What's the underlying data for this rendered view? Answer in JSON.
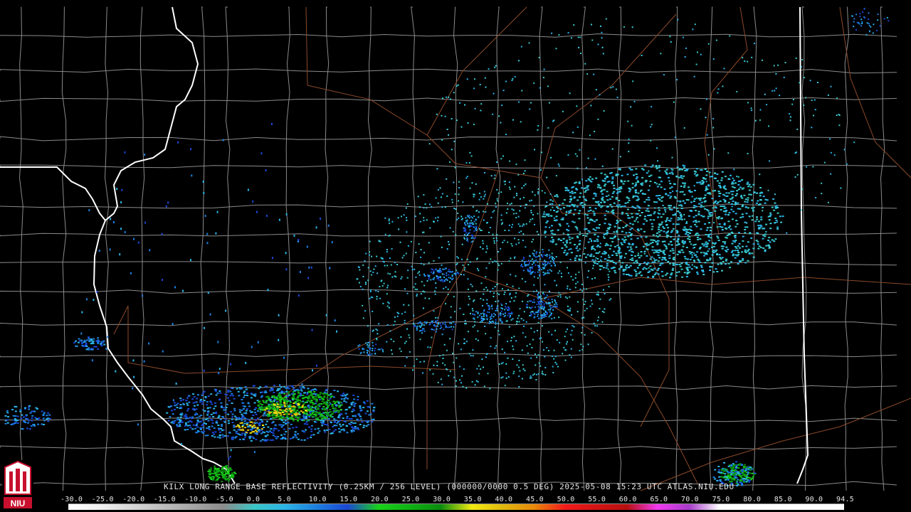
{
  "caption": "KILX LONG RANGE BASE REFLECTIVITY (0.25KM / 256 LEVEL) (000000/0000 0.5 DEG) 2025-05-08 15:23 UTC  ATLAS.NIU.EDU",
  "logo_text": "NIU",
  "scale_labels": [
    "-30.0",
    "-25.0",
    "-20.0",
    "-15.0",
    "-10.0",
    "-5.0",
    "0.0",
    "5.0",
    "10.0",
    "15.0",
    "20.0",
    "25.0",
    "30.0",
    "35.0",
    "40.0",
    "45.0",
    "50.0",
    "55.0",
    "60.0",
    "65.0",
    "70.0",
    "75.0",
    "80.0",
    "85.0",
    "90.0",
    "94.5"
  ],
  "scale_colors": [
    "#ffffff",
    "#f2f2f2",
    "#d9d9d9",
    "#bfbfbf",
    "#a6a6a6",
    "#8c8c8c",
    "#39c6c6",
    "#2bb4e8",
    "#1c7fe0",
    "#1b47d6",
    "#19d11a",
    "#0fb213",
    "#0a8c0e",
    "#f2ea10",
    "#e0b80e",
    "#e88a0a",
    "#f21a1a",
    "#d21414",
    "#b80f0f",
    "#f23af2",
    "#a83ccc",
    "#ffffff",
    "#ffffff",
    "#ffffff",
    "#ffffff"
  ],
  "colors": {
    "state_border": "#ffffff",
    "county_line": "#8a8a8a",
    "highway": "#8b4a2a",
    "logo_red": "#c8102e"
  }
}
